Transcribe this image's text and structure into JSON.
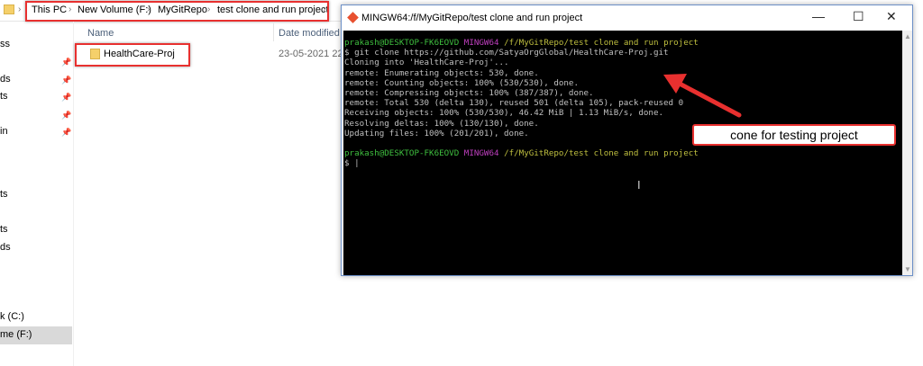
{
  "explorer": {
    "breadcrumb": [
      "This PC",
      "New Volume (F:)",
      "MyGitRepo",
      "test clone and run project"
    ],
    "columns": {
      "name": "Name",
      "date": "Date modified"
    },
    "files": [
      {
        "name": "HealthCare-Proj",
        "date": "23-05-2021 22:31"
      }
    ],
    "sidebar": [
      "ss",
      "ds",
      "ts",
      "in",
      "ts",
      "ts",
      "ds",
      "k (C:)",
      "me (F:)"
    ]
  },
  "terminal": {
    "title": "MINGW64:/f/MyGitRepo/test clone and run project",
    "prompt_user": "prakash@DESKTOP-FK6EOVD",
    "prompt_env": "MINGW64",
    "prompt_path": "/f/MyGitRepo/test clone and run project",
    "command": "$ git clone https://github.com/SatyaOrgGlobal/HealthCare-Proj.git",
    "output": [
      "Cloning into 'HealthCare-Proj'...",
      "remote: Enumerating objects: 530, done.",
      "remote: Counting objects: 100% (530/530), done.",
      "remote: Compressing objects: 100% (387/387), done.",
      "remote: Total 530 (delta 130), reused 501 (delta 105), pack-reused 0",
      "Receiving objects: 100% (530/530), 46.42 MiB | 1.13 MiB/s, done.",
      "Resolving deltas: 100% (130/130), done.",
      "Updating files: 100% (201/201), done."
    ],
    "prompt2": "$ |"
  },
  "annotation": {
    "text": "cone for testing project",
    "color": "#e8302f"
  }
}
